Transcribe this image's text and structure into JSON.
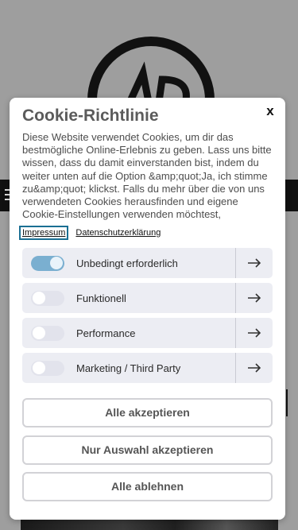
{
  "modal": {
    "title": "Cookie-Richtlinie",
    "close_label": "x",
    "description": "Diese Website verwendet Cookies, um dir das bestmögliche Online-Erlebnis zu geben. Lass uns bitte wissen, dass du damit einverstanden bist, indem du weiter unten auf die Option &amp;quot;Ja, ich stimme zu&amp;quot; klickst. Falls du mehr über die von uns verwendeten Cookies herausfinden und eigene Cookie-Einstellungen verwenden möchtest,",
    "links": {
      "impressum": "Impressum",
      "datenschutz": "Datenschutzerklärung"
    },
    "categories": [
      {
        "label": "Unbedingt erforderlich",
        "enabled": true
      },
      {
        "label": "Funktionell",
        "enabled": false
      },
      {
        "label": "Performance",
        "enabled": false
      },
      {
        "label": "Marketing / Third Party",
        "enabled": false
      }
    ],
    "buttons": {
      "accept_all": "Alle akzeptieren",
      "accept_selection": "Nur Auswahl akzeptieren",
      "reject_all": "Alle ablehnen"
    }
  },
  "colors": {
    "overlay_bg": "#9e9e9e",
    "toggle_on": "#7aafd0",
    "category_bg": "#ecedf3",
    "focus_outline": "#1a6f93"
  },
  "icons": {
    "close": "close-icon",
    "arrow": "arrow-right-icon",
    "menu": "hamburger-menu-icon"
  }
}
